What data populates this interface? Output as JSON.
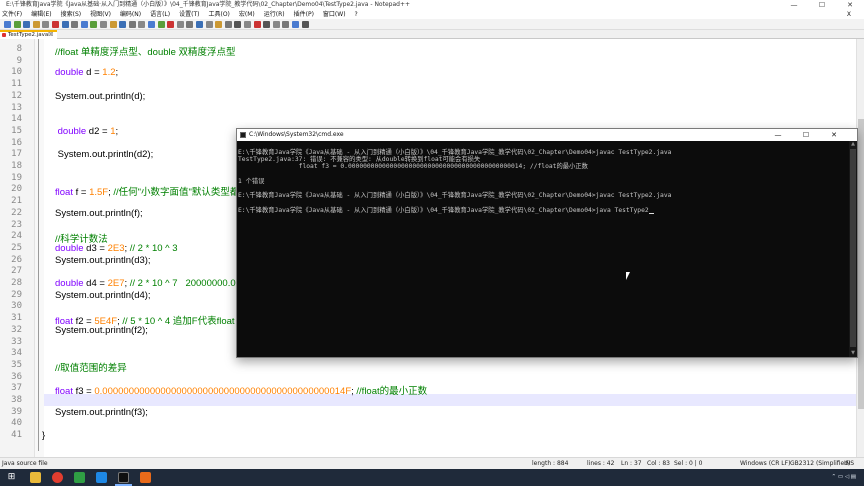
{
  "npp": {
    "title": "E:\\千锋教育Java学院《Java从基础·从入门到精通（小白版）》\\04_千锋教育Java学院_教学代码\\02_Chapter\\Demo04\\TestType2.java - Notepad++",
    "win_minimize": "—",
    "win_maximize": "☐",
    "win_close": "✕",
    "menu": [
      "文件(F)",
      "编辑(E)",
      "搜索(S)",
      "视图(V)",
      "编码(N)",
      "语言(L)",
      "设置(T)",
      "工具(O)",
      "宏(M)",
      "运行(R)",
      "插件(P)",
      "窗口(W)",
      "?"
    ],
    "menu_close": "X",
    "tab_label": "TestType2.java☒",
    "status": {
      "file_type": "Java source file",
      "length": "length : 884",
      "lines": "lines : 42",
      "ln": "Ln : 37",
      "col": "Col : 83",
      "sel": "Sel : 0 | 0",
      "eol": "Windows (CR LF)",
      "encoding": "GB2312 (Simplified)",
      "mode": "INS"
    }
  },
  "code_lines": [
    {
      "n": "8",
      "segments": [
        {
          "t": "//float 单精度浮点型、double 双精度浮点型",
          "c": "cm"
        }
      ]
    },
    {
      "n": "9",
      "segments": []
    },
    {
      "n": "10",
      "segments": [
        {
          "t": "double",
          "c": "kw"
        },
        {
          "t": " d = ",
          "c": ""
        },
        {
          "t": "1.2",
          "c": "num"
        },
        {
          "t": ";",
          "c": ""
        }
      ]
    },
    {
      "n": "11",
      "segments": []
    },
    {
      "n": "12",
      "segments": [
        {
          "t": "System.out.println(d);",
          "c": ""
        }
      ]
    },
    {
      "n": "13",
      "segments": []
    },
    {
      "n": "14",
      "segments": []
    },
    {
      "n": "15",
      "segments": [
        {
          "t": " double",
          "c": "kw"
        },
        {
          "t": " d2 = ",
          "c": ""
        },
        {
          "t": "1",
          "c": "num"
        },
        {
          "t": ";",
          "c": ""
        }
      ]
    },
    {
      "n": "16",
      "segments": []
    },
    {
      "n": "17",
      "segments": [
        {
          "t": " System.out.println(d2);",
          "c": ""
        }
      ]
    },
    {
      "n": "18",
      "segments": []
    },
    {
      "n": "19",
      "segments": []
    },
    {
      "n": "20",
      "segments": [
        {
          "t": "float",
          "c": "kw"
        },
        {
          "t": " f = ",
          "c": ""
        },
        {
          "t": "1.5F",
          "c": "num"
        },
        {
          "t": "; ",
          "c": ""
        },
        {
          "t": "//任何\"小数字面值\"默认类型都是",
          "c": "cm"
        }
      ]
    },
    {
      "n": "21",
      "segments": []
    },
    {
      "n": "22",
      "segments": [
        {
          "t": "System.out.println(f);",
          "c": ""
        }
      ]
    },
    {
      "n": "23",
      "segments": []
    },
    {
      "n": "24",
      "segments": [
        {
          "t": "//科学计数法",
          "c": "cm"
        }
      ]
    },
    {
      "n": "25",
      "segments": [
        {
          "t": "double",
          "c": "kw"
        },
        {
          "t": " d3 = ",
          "c": ""
        },
        {
          "t": "2E3",
          "c": "num"
        },
        {
          "t": "; ",
          "c": ""
        },
        {
          "t": "// 2 * 10 ^ 3",
          "c": "cm"
        }
      ]
    },
    {
      "n": "26",
      "segments": [
        {
          "t": "System.out.println(d3);",
          "c": ""
        }
      ]
    },
    {
      "n": "27",
      "segments": []
    },
    {
      "n": "28",
      "segments": [
        {
          "t": "double",
          "c": "kw"
        },
        {
          "t": " d4 = ",
          "c": ""
        },
        {
          "t": "2E7",
          "c": "num"
        },
        {
          "t": "; ",
          "c": ""
        },
        {
          "t": "// 2 * 10 ^ 7   20000000.0",
          "c": "cm"
        }
      ]
    },
    {
      "n": "29",
      "segments": [
        {
          "t": "System.out.println(d4);",
          "c": ""
        }
      ]
    },
    {
      "n": "30",
      "segments": []
    },
    {
      "n": "31",
      "segments": [
        {
          "t": "float",
          "c": "kw"
        },
        {
          "t": " f2 = ",
          "c": ""
        },
        {
          "t": "5E4F",
          "c": "num"
        },
        {
          "t": "; ",
          "c": ""
        },
        {
          "t": "// 5 * 10 ^ 4 追加F代表float",
          "c": "cm"
        }
      ]
    },
    {
      "n": "32",
      "segments": [
        {
          "t": "System.out.println(f2);",
          "c": ""
        }
      ]
    },
    {
      "n": "33",
      "segments": []
    },
    {
      "n": "34",
      "segments": []
    },
    {
      "n": "35",
      "segments": [
        {
          "t": "//取值范围的差异",
          "c": "cm"
        }
      ]
    },
    {
      "n": "36",
      "segments": []
    },
    {
      "n": "37",
      "segments": [
        {
          "t": "float",
          "c": "kw"
        },
        {
          "t": " f3 = ",
          "c": ""
        },
        {
          "t": "0.0000000000000000000000000000000000000000000014F",
          "c": "num"
        },
        {
          "t": "; ",
          "c": ""
        },
        {
          "t": "//float的最小正数",
          "c": "cm"
        }
      ]
    },
    {
      "n": "38",
      "segments": []
    },
    {
      "n": "39",
      "segments": [
        {
          "t": "System.out.println(f3);",
          "c": ""
        }
      ]
    },
    {
      "n": "40",
      "segments": []
    },
    {
      "n": "41",
      "segments": [
        {
          "t": "}",
          "c": ""
        }
      ]
    }
  ],
  "cmd": {
    "title": "C:\\Windows\\System32\\cmd.exe",
    "min": "—",
    "max": "☐",
    "close": "✕",
    "lines": [
      "E:\\千锋教育Java学院《Java从基础 - 从入门到精通（小白版）》\\04_千锋教育Java学院_教学代码\\02_Chapter\\Demo04>javac TestType2.java",
      "TestType2.java:37: 错误: 不兼容的类型: 从double转换到float可能会有损失",
      "                float f3 = 0.0000000000000000000000000000000000000000000014; //float的最小正数",
      "",
      "1 个错误",
      "",
      "E:\\千锋教育Java学院《Java从基础 - 从入门到精通（小白版）》\\04_千锋教育Java学院_教学代码\\02_Chapter\\Demo04>javac TestType2.java",
      "",
      "E:\\千锋教育Java学院《Java从基础 - 从入门到精通（小白版）》\\04_千锋教育Java学院_教学代码\\02_Chapter\\Demo04>java TestType2"
    ]
  },
  "colors": {
    "keyword": "#8000ff",
    "number": "#ff8000",
    "comment": "#008000",
    "current_line": "#e8e8ff",
    "console_bg": "#0c0c0c"
  }
}
